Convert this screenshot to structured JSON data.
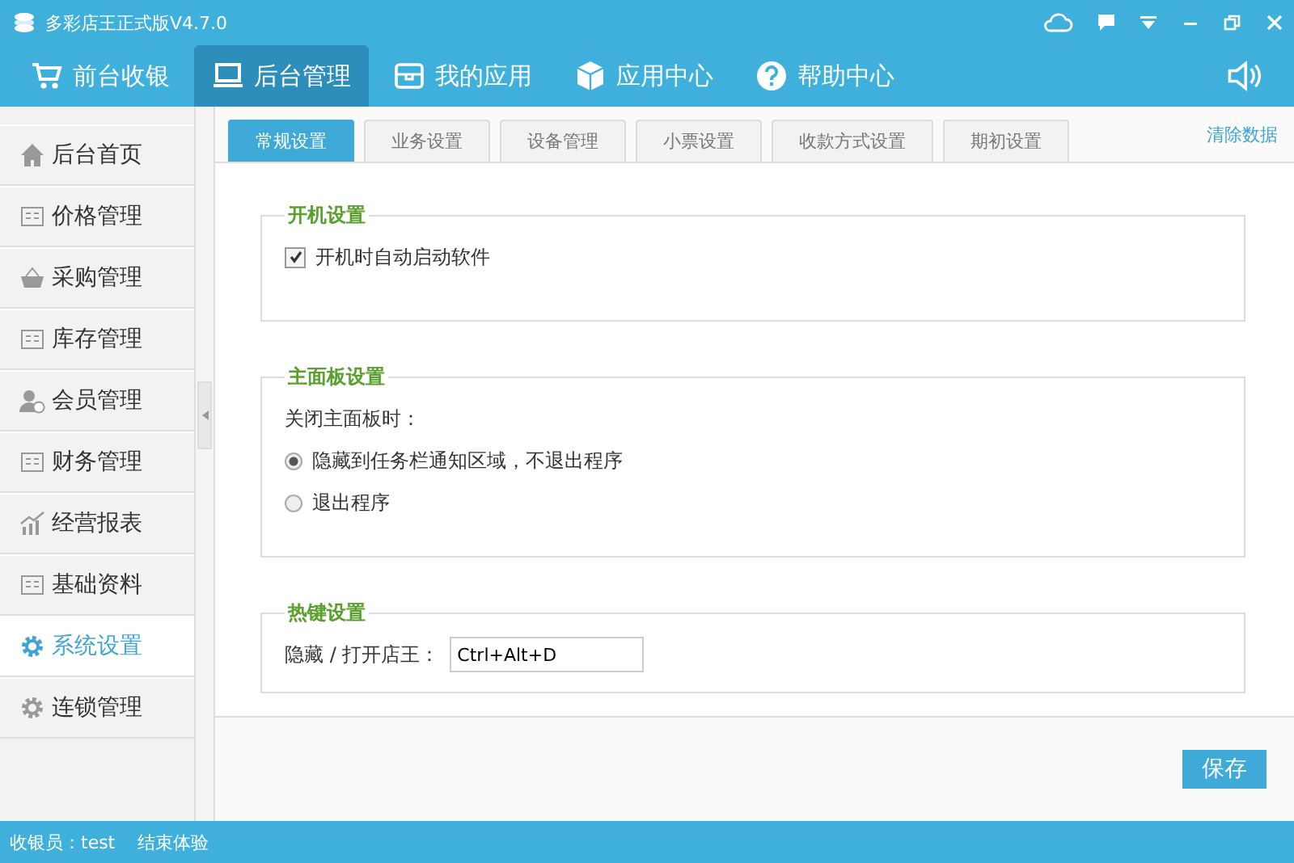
{
  "window": {
    "title": "多彩店王正式版V4.7.0"
  },
  "nav": [
    {
      "label": "前台收银",
      "kind": "cart",
      "selected": false
    },
    {
      "label": "后台管理",
      "kind": "monitor",
      "selected": true
    },
    {
      "label": "我的应用",
      "kind": "box",
      "selected": false
    },
    {
      "label": "应用中心",
      "kind": "cube",
      "selected": false
    },
    {
      "label": "帮助中心",
      "kind": "help",
      "selected": false
    }
  ],
  "sidebar": {
    "items": [
      {
        "label": "后台首页",
        "kind": "home",
        "selected": false
      },
      {
        "label": "价格管理",
        "kind": "doc",
        "selected": false
      },
      {
        "label": "采购管理",
        "kind": "basket",
        "selected": false
      },
      {
        "label": "库存管理",
        "kind": "doc",
        "selected": false
      },
      {
        "label": "会员管理",
        "kind": "user",
        "selected": false
      },
      {
        "label": "财务管理",
        "kind": "doc",
        "selected": false
      },
      {
        "label": "经营报表",
        "kind": "chart",
        "selected": false
      },
      {
        "label": "基础资料",
        "kind": "doc",
        "selected": false
      },
      {
        "label": "系统设置",
        "kind": "gear",
        "selected": true
      },
      {
        "label": "连锁管理",
        "kind": "gear",
        "selected": false
      }
    ]
  },
  "tabs": [
    {
      "label": "常规设置",
      "selected": true
    },
    {
      "label": "业务设置",
      "selected": false
    },
    {
      "label": "设备管理",
      "selected": false
    },
    {
      "label": "小票设置",
      "selected": false
    },
    {
      "label": "收款方式设置",
      "selected": false
    },
    {
      "label": "期初设置",
      "selected": false
    }
  ],
  "clear_link": "清除数据",
  "startup": {
    "title": "开机设置",
    "option": {
      "label": "开机时自动启动软件",
      "checked": true
    }
  },
  "panel": {
    "title": "主面板设置",
    "prompt": "关闭主面板时：",
    "options": [
      {
        "label": "隐藏到任务栏通知区域，不退出程序",
        "selected": true
      },
      {
        "label": "退出程序",
        "selected": false
      }
    ]
  },
  "hotkey": {
    "title": "热键设置",
    "label": "隐藏 / 打开店王：",
    "value": "Ctrl+Alt+D"
  },
  "save_button": "保存",
  "status_bar": {
    "cashier": "收银员：test",
    "end": "结束体验"
  }
}
